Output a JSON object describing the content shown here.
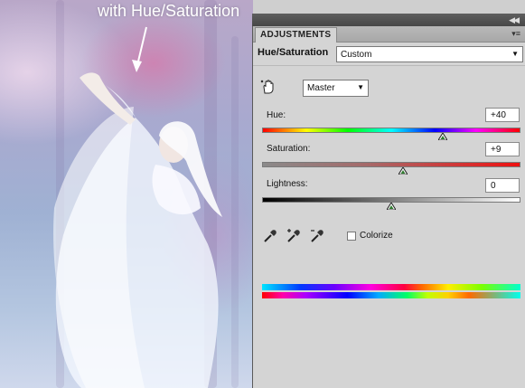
{
  "photo": {
    "caption": "with Hue/Saturation"
  },
  "panel": {
    "tab_label": "ADJUSTMENTS",
    "adjustment_title": "Hue/Saturation",
    "preset_value": "Custom",
    "channel_value": "Master",
    "sliders": {
      "hue": {
        "label": "Hue:",
        "value": "+40",
        "level": 0.7
      },
      "saturation": {
        "label": "Saturation:",
        "value": "+9",
        "level": 0.545
      },
      "lightness": {
        "label": "Lightness:",
        "value": "0",
        "level": 0.5
      }
    },
    "colorize_label": "Colorize",
    "colorize_checked": false,
    "icons": [
      "collapse-icon",
      "panel-menu-icon",
      "hand-tool-icon",
      "eyedropper-icon",
      "eyedropper-plus-icon",
      "eyedropper-minus-icon",
      "chevron-down-icon"
    ]
  }
}
